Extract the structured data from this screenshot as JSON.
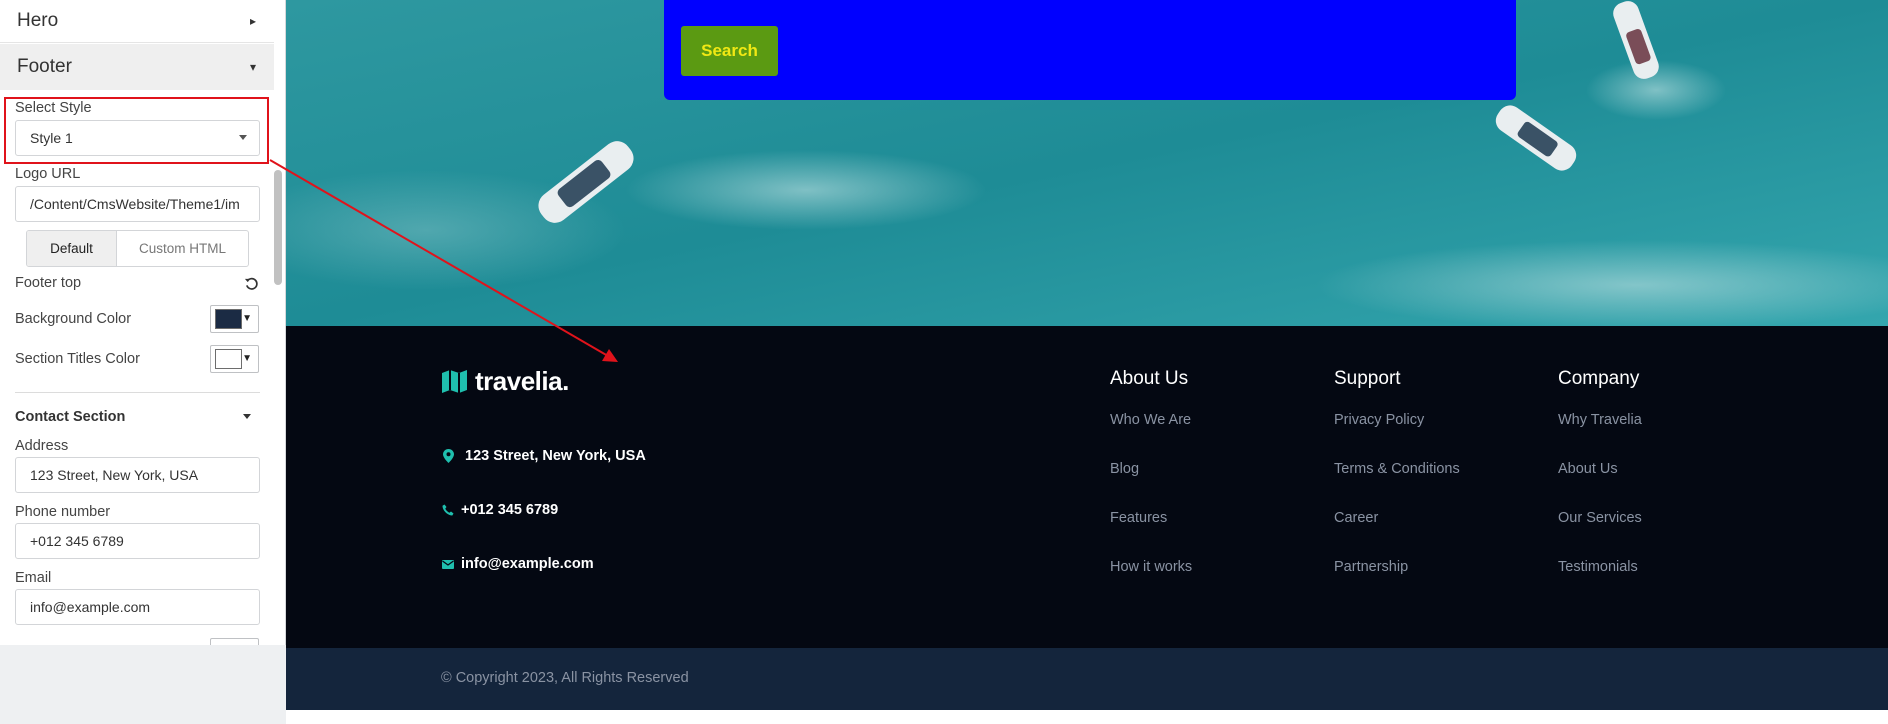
{
  "sidebar": {
    "hero_label": "Hero",
    "footer_label": "Footer",
    "select_style_label": "Select Style",
    "select_style_value": "Style 1",
    "logo_url_label": "Logo URL",
    "logo_url_value": "/Content/CmsWebsite/Theme1/im",
    "tabs": [
      "Default",
      "Custom HTML"
    ],
    "footer_top_label": "Footer top",
    "background_color_label": "Background Color",
    "background_color": "#1b2b44",
    "section_titles_color_label": "Section Titles Color",
    "section_titles_color": "#ffffff",
    "contact_section_label": "Contact Section",
    "address_label": "Address",
    "address_value": "123 Street, New York, USA",
    "phone_label": "Phone number",
    "phone_value": "+012 345 6789",
    "email_label": "Email",
    "email_value": "info@example.com"
  },
  "hero": {
    "search_label": "Search"
  },
  "footer": {
    "brand": "travelia.",
    "address": "123 Street, New York, USA",
    "phone": "+012 345 6789",
    "email": "info@example.com",
    "columns": [
      {
        "title": "About Us",
        "links": [
          "Who We Are",
          "Blog",
          "Features",
          "How it works"
        ]
      },
      {
        "title": "Support",
        "links": [
          "Privacy Policy",
          "Terms & Conditions",
          "Career",
          "Partnership"
        ]
      },
      {
        "title": "Company",
        "links": [
          "Why Travelia",
          "About Us",
          "Our Services",
          "Testimonials"
        ]
      }
    ],
    "copyright": "© Copyright 2023, All Rights Reserved"
  },
  "colors": {
    "accent_teal": "#1fbfae",
    "highlight_red": "#e0131b",
    "search_box_blue": "#0000ff",
    "search_button_green": "#5b9a12"
  }
}
